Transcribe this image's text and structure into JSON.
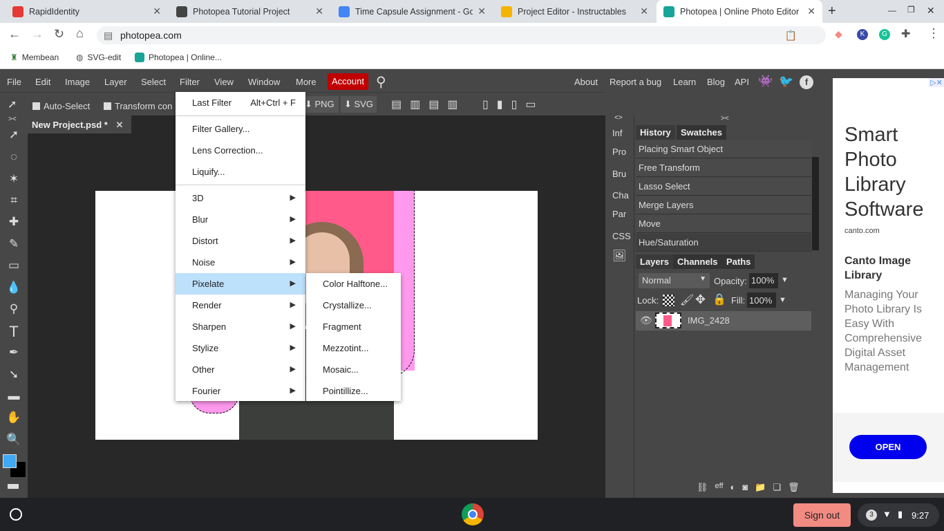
{
  "browser": {
    "tabs": [
      {
        "title": "RapidIdentity",
        "color": "#e53935"
      },
      {
        "title": "Photopea Tutorial Project",
        "color": "#444"
      },
      {
        "title": "Time Capsule Assignment - Goo",
        "color": "#4285f4"
      },
      {
        "title": "Project Editor - Instructables",
        "color": "#f4b400"
      },
      {
        "title": "Photopea | Online Photo Editor",
        "color": "#18a497"
      }
    ],
    "url": "photopea.com",
    "bookmarks": [
      "Membean",
      "SVG-edit",
      "Photopea | Online..."
    ]
  },
  "menubar": {
    "items": [
      "File",
      "Edit",
      "Image",
      "Layer",
      "Select",
      "Filter",
      "View",
      "Window",
      "More"
    ],
    "account": "Account",
    "right": [
      "About",
      "Report a bug",
      "Learn",
      "Blog",
      "API"
    ]
  },
  "toolbar": {
    "auto_select": "Auto-Select",
    "transform": "Transform con",
    "png": "PNG",
    "svg": "SVG"
  },
  "document": {
    "tab": "New Project.psd *"
  },
  "filter_menu": {
    "last_filter": "Last Filter",
    "last_filter_shortcut": "Alt+Ctrl + F",
    "group1": [
      "Filter Gallery...",
      "Lens Correction...",
      "Liquify..."
    ],
    "submenus": [
      "3D",
      "Blur",
      "Distort",
      "Noise",
      "Pixelate",
      "Render",
      "Sharpen",
      "Stylize",
      "Other",
      "Fourier"
    ],
    "highlighted": "Pixelate"
  },
  "pixelate_submenu": [
    "Color Halftone...",
    "Crystallize...",
    "Fragment",
    "Mezzotint...",
    "Mosaic...",
    "Pointillize..."
  ],
  "side_collapsed": [
    "Inf",
    "Pro",
    "Bru",
    "Cha",
    "Par",
    "CSS"
  ],
  "history": {
    "tabs": [
      "History",
      "Swatches"
    ],
    "items": [
      "Placing Smart Object",
      "Free Transform",
      "Lasso Select",
      "Merge Layers",
      "Move",
      "Hue/Saturation"
    ]
  },
  "layers": {
    "tabs": [
      "Layers",
      "Channels",
      "Paths"
    ],
    "blend": "Normal",
    "opacity_label": "Opacity:",
    "opacity": "100%",
    "lock_label": "Lock:",
    "fill_label": "Fill:",
    "fill": "100%",
    "items": [
      {
        "name": "IMG_2428"
      }
    ],
    "footer_eff": "eff"
  },
  "ad": {
    "title": "Smart Photo Library Software",
    "domain": "canto.com",
    "subtitle": "Canto Image Library",
    "body": "Managing Your Photo Library Is Easy With Comprehensive Digital Asset Management",
    "button": "OPEN"
  },
  "taskbar": {
    "sign_out": "Sign out",
    "notifications": "3",
    "time": "9:27"
  },
  "colors": {
    "accent": "#c00000",
    "highlight": "#bde0fb",
    "foreground": "#3fa9f5",
    "background": "#000000"
  }
}
